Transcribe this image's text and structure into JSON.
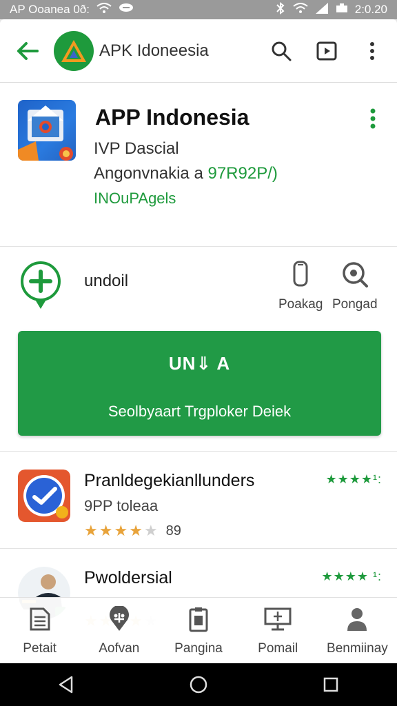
{
  "status_bar": {
    "left_text": "AP Ooanea 0ð:",
    "time": "2:0.20",
    "icons": [
      "wifi-icon",
      "message-icon",
      "bluetooth-icon",
      "signal-icon",
      "battery-icon"
    ]
  },
  "app_bar": {
    "title": "APK Idoneesia",
    "icons": [
      "back-arrow-icon",
      "search-icon",
      "play-icon",
      "more-vert-icon"
    ]
  },
  "app": {
    "name": "APP Indonesia",
    "developer": "IVP Dascial",
    "category_prefix": "Angonvnakia a",
    "category_code": "97R92P/)",
    "tag": "INOuPAgels"
  },
  "install": {
    "label": "undoil",
    "actions": [
      {
        "label": "Poakag",
        "icon": "phone-icon"
      },
      {
        "label": "Pongad",
        "icon": "search-icon"
      }
    ]
  },
  "main_button": {
    "primary": "UN⇓ A",
    "secondary": "Seolbyaart Trgploker Deiek"
  },
  "list": [
    {
      "title": "Pranldegekianllunders",
      "subtitle": "9PP toleaa",
      "rating_count": "89",
      "stars_filled": 4,
      "green_stars": "★★★★¹: "
    },
    {
      "title": "Pwoldersial",
      "subtitle": "",
      "rating_count": "",
      "stars_filled": 4,
      "green_stars": "★★★★ ¹:"
    }
  ],
  "bottom_nav": [
    {
      "label": "Petait",
      "icon": "document-icon"
    },
    {
      "label": "Aofvan",
      "icon": "location-pin-icon"
    },
    {
      "label": "Pangina",
      "icon": "clipboard-icon"
    },
    {
      "label": "Pomail",
      "icon": "monitor-icon"
    },
    {
      "label": "Benmiinay",
      "icon": "person-icon"
    }
  ],
  "colors": {
    "accent_green": "#219a46",
    "text_green": "#1e9a3c",
    "star_orange": "#e8a33a",
    "app_icon_blue": "#1f63c9"
  }
}
